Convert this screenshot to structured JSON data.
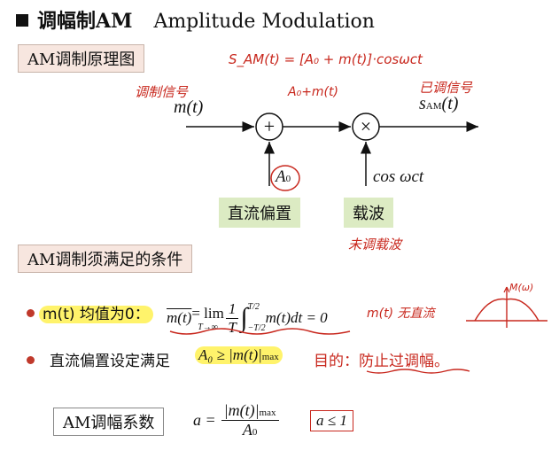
{
  "title": {
    "zh": "调幅制AM",
    "en": "Amplitude Modulation"
  },
  "section1": {
    "label": "AM调制原理图"
  },
  "diagram": {
    "formula_note": "S_AM(t) = [A₀ + m(t)]·cosωct",
    "input_note": "调制信号",
    "input": "m(t)",
    "sum_note": "A₀+m(t)",
    "output_note": "已调信号",
    "output": "s",
    "output_sub": "AM",
    "output_arg": "(t)",
    "adder_symbol": "+",
    "mult_symbol": "×",
    "dc": "A",
    "dc_sub": "0",
    "carrier": "cos ωct",
    "dc_label": "直流偏置",
    "carrier_label": "载波",
    "carrier_note": "未调载波"
  },
  "section2": {
    "label": "AM调制须满足的条件"
  },
  "cond1": {
    "prefix": "m(t) 均值为0：",
    "lhs": "m(t)",
    "eq1": " = lim",
    "lim_sub": "T→∞",
    "one": "1",
    "T": "T",
    "integral": "∫",
    "int_upper": "T/2",
    "int_lower": "−T/2",
    "rest": "m(t)dt = 0",
    "note": "m(t) 无直流",
    "spectrum_label": "M(ω)"
  },
  "cond2": {
    "text": "直流偏置设定满足",
    "formula": "A₀ ≥ |m(t)|",
    "formula_sub": "max",
    "purpose": "目的：防止过调幅。"
  },
  "coef": {
    "label": "AM调幅系数",
    "lhs": "a =",
    "num": "|m(t)|",
    "num_sub": "max",
    "den": "A",
    "den_sub": "0",
    "cond": "a ≤ 1"
  },
  "colors": {
    "annotation": "#c8281e",
    "highlight": "#fff36b",
    "green_box": "#dcebc3",
    "tag_box": "#f7e6df"
  }
}
